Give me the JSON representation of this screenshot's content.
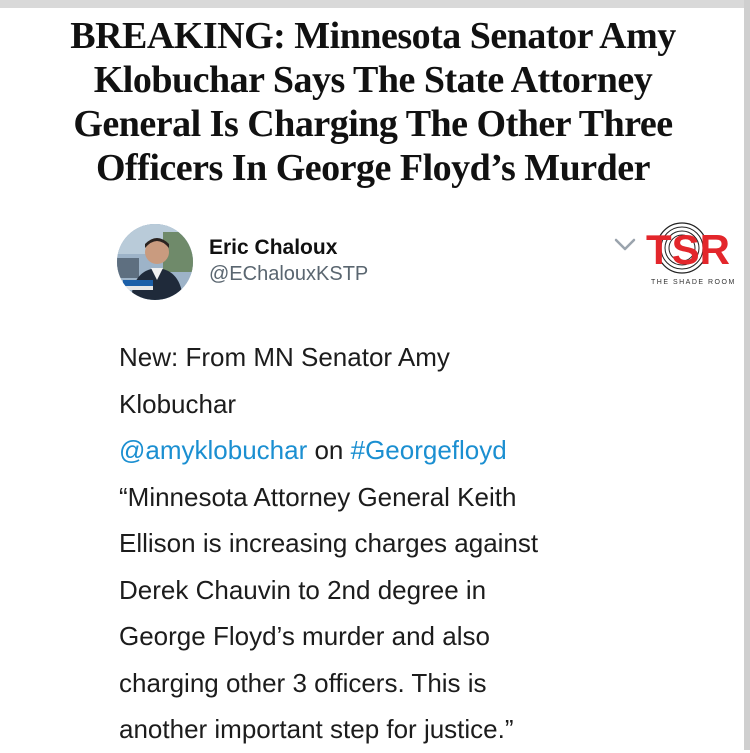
{
  "headline": {
    "lines": [
      "BREAKING: Minnesota Senator Amy",
      "Klobuchar Says The State Attorney",
      "General Is Charging The Other Three",
      "Officers In George Floyd’s Murder"
    ]
  },
  "tweet": {
    "author_name": "Eric Chaloux",
    "author_handle": "@EChalouxKSTP",
    "line1": "New: From MN Senator Amy",
    "line2": "Klobuchar",
    "mention": "@amyklobuchar",
    "on_text": " on ",
    "hashtag": "#Georgefloyd",
    "quote_lines": [
      "“Minnesota Attorney General Keith",
      "Ellison is increasing charges against",
      "Derek Chauvin to 2nd degree in",
      "George Floyd’s murder and also",
      "charging other 3 officers. This is",
      "another important step for justice.”"
    ]
  },
  "watermark": {
    "logo_text": "TSR",
    "caption": "THE SHADE ROOM"
  },
  "colors": {
    "link": "#1b8fd1",
    "logo_red": "#e3262b"
  },
  "icons": [
    "avatar-photo",
    "chevron-down-icon",
    "tsr-logo"
  ]
}
